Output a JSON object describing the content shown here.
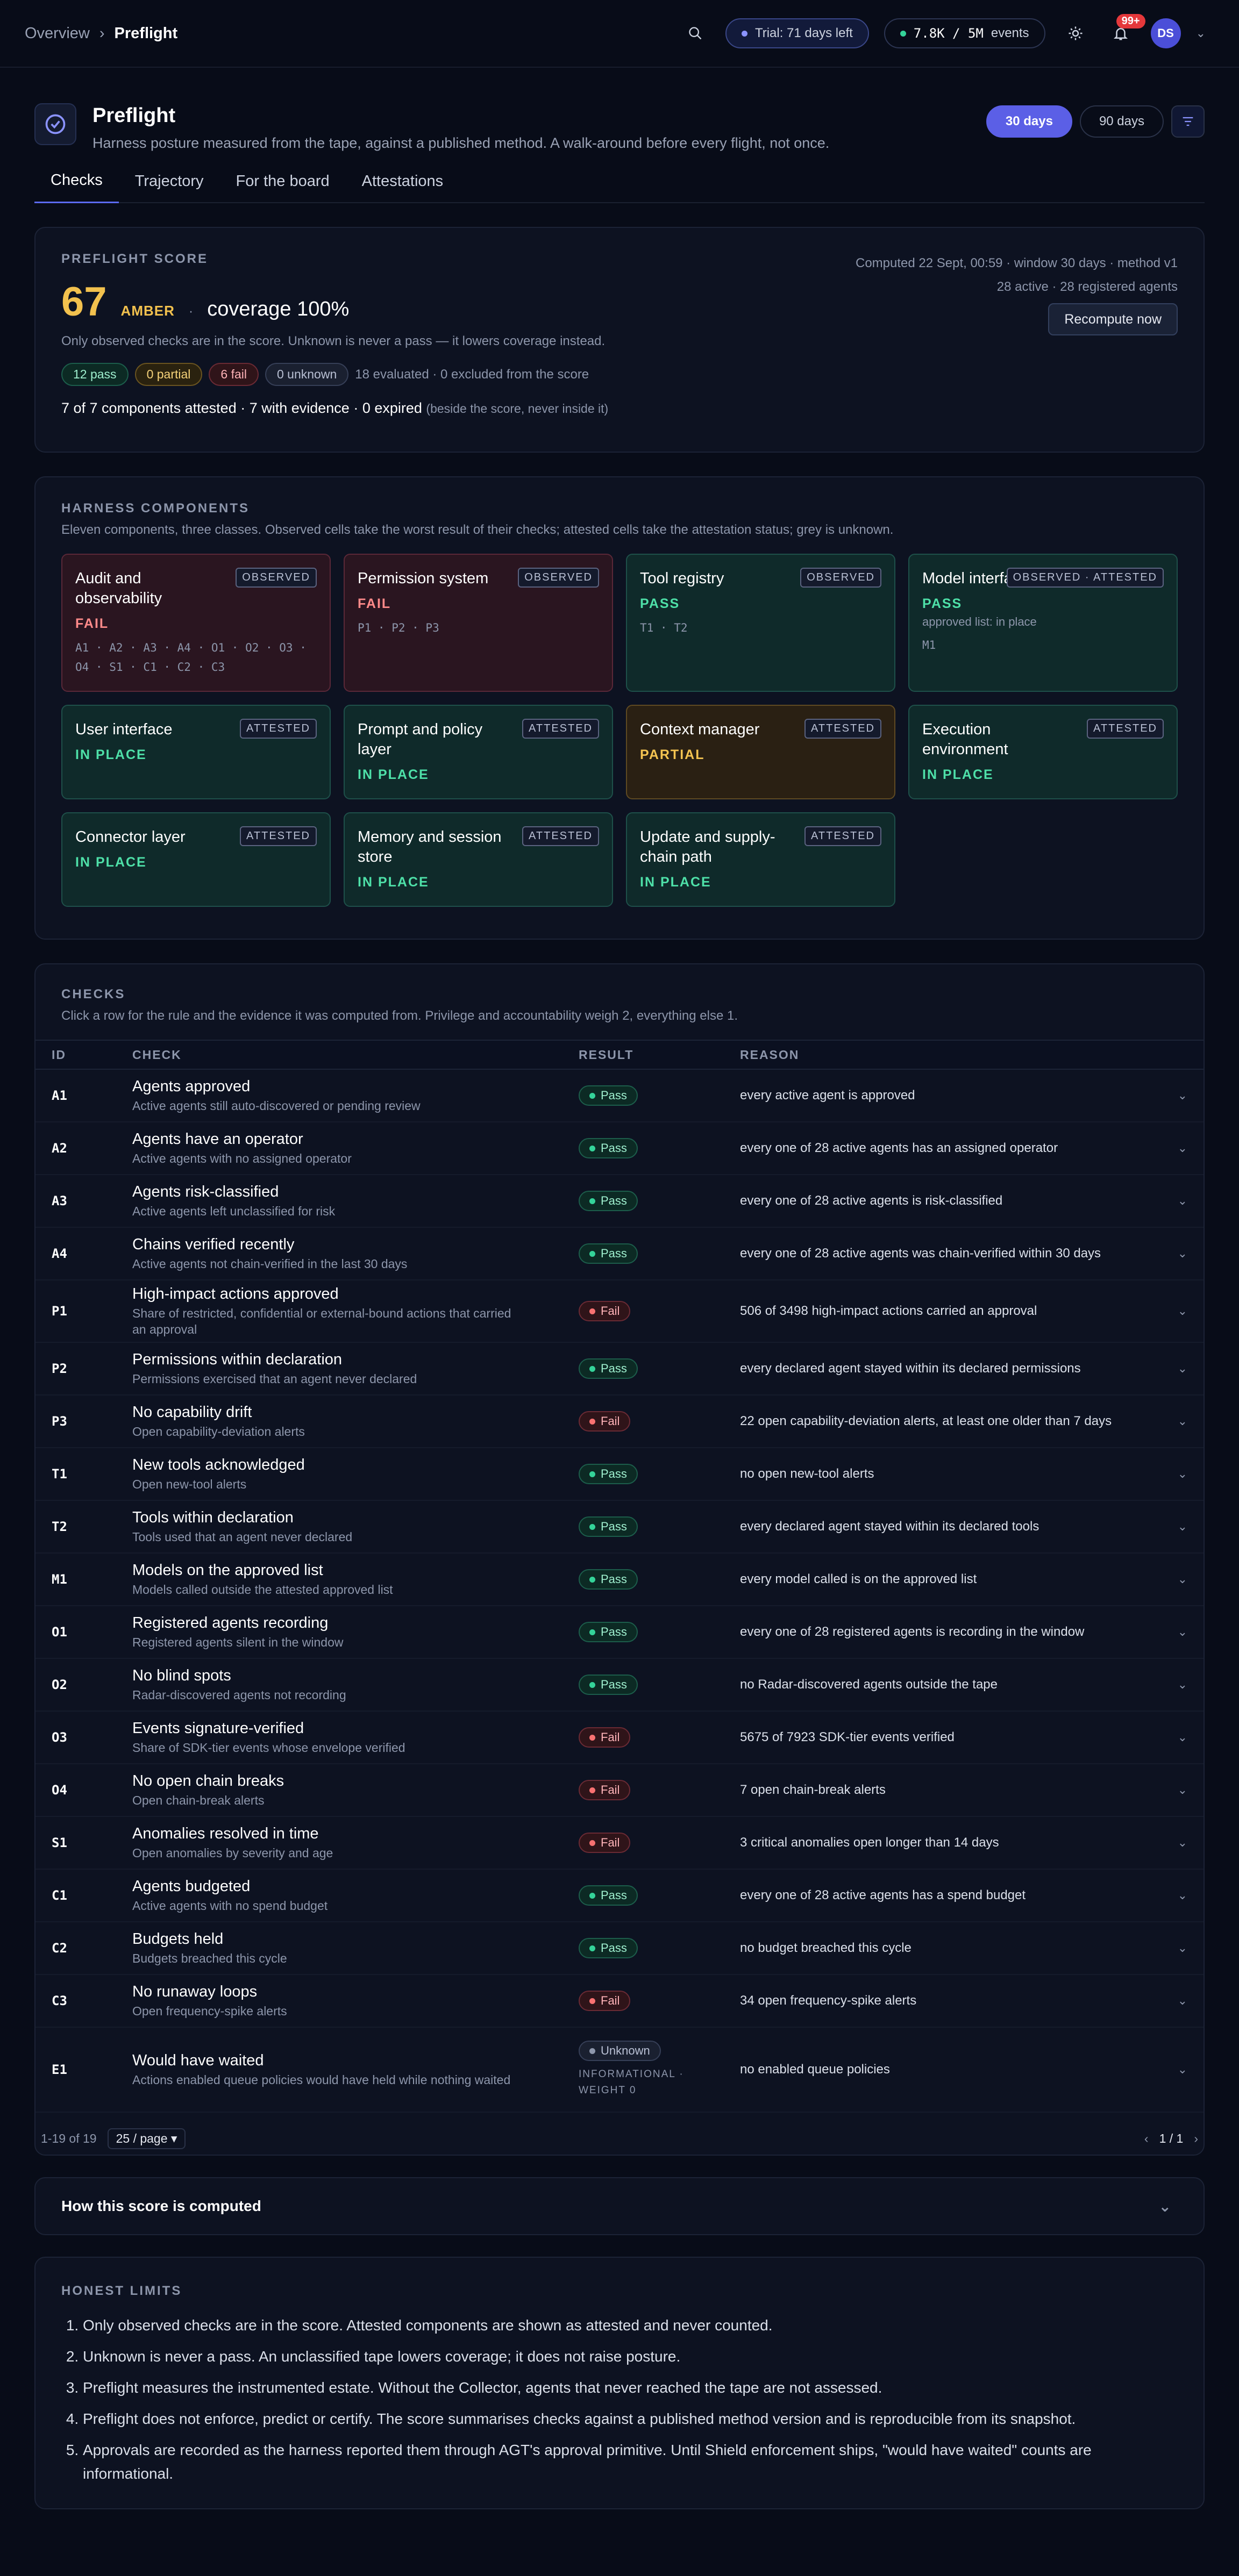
{
  "nav": {
    "overview": "Overview",
    "current": "Preflight",
    "trial": "Trial: 71 days left",
    "events_count": "7.8K / 5M",
    "events_label": "events",
    "notif_count": "99+",
    "avatar": "DS"
  },
  "header": {
    "title": "Preflight",
    "subtitle": "Harness posture measured from the tape, against a published method. A walk-around before every flight, not once.",
    "range_30": "30 days",
    "range_90": "90 days"
  },
  "tabs": [
    "Checks",
    "Trajectory",
    "For the board",
    "Attestations"
  ],
  "score": {
    "label": "PREFLIGHT SCORE",
    "value": "67",
    "band": "AMBER",
    "coverage": "coverage 100%",
    "computed": "Computed 22 Sept, 00:59 · window 30 days · method v1",
    "agents": "28 active · 28 registered agents",
    "recompute": "Recompute now",
    "note": "Only observed checks are in the score. Unknown is never a pass — it lowers coverage instead.",
    "chips": {
      "pass": "12 pass",
      "partial": "0 partial",
      "fail": "6 fail",
      "unknown": "0 unknown"
    },
    "evaluated": "18 evaluated · 0 excluded from the score",
    "attest": "7 of 7 components attested · 7 with evidence · 0 expired",
    "attest_note": "(beside the score, never inside it)",
    "colors": {
      "amber": "#f2c14e",
      "pass": "#34d399",
      "fail": "#f87171"
    }
  },
  "components": {
    "label": "HARNESS COMPONENTS",
    "desc": "Eleven components, three classes. Observed cells take the worst result of their checks; attested cells take the attestation status; grey is unknown.",
    "items": [
      {
        "name": "Audit and observability",
        "tag": "OBSERVED",
        "status": "FAIL",
        "kind": "fail",
        "ids": "A1 · A2 · A3 · A4 · O1 · O2 · O3 · O4 · S1 · C1 · C2 · C3"
      },
      {
        "name": "Permission system",
        "tag": "OBSERVED",
        "status": "FAIL",
        "kind": "fail",
        "ids": "P1 · P2 · P3"
      },
      {
        "name": "Tool registry",
        "tag": "OBSERVED",
        "status": "PASS",
        "kind": "pass",
        "ids": "T1 · T2"
      },
      {
        "name": "Model interface",
        "tag": "OBSERVED · ATTESTED",
        "status": "PASS",
        "kind": "pass",
        "extra": "approved list: in place",
        "ids": "M1"
      },
      {
        "name": "User interface",
        "tag": "ATTESTED",
        "status": "IN PLACE",
        "kind": "pass"
      },
      {
        "name": "Prompt and policy layer",
        "tag": "ATTESTED",
        "status": "IN PLACE",
        "kind": "pass"
      },
      {
        "name": "Context manager",
        "tag": "ATTESTED",
        "status": "PARTIAL",
        "kind": "part"
      },
      {
        "name": "Execution environment",
        "tag": "ATTESTED",
        "status": "IN PLACE",
        "kind": "pass"
      },
      {
        "name": "Connector layer",
        "tag": "ATTESTED",
        "status": "IN PLACE",
        "kind": "pass"
      },
      {
        "name": "Memory and session store",
        "tag": "ATTESTED",
        "status": "IN PLACE",
        "kind": "pass"
      },
      {
        "name": "Update and supply-chain path",
        "tag": "ATTESTED",
        "status": "IN PLACE",
        "kind": "pass"
      }
    ]
  },
  "checks": {
    "label": "CHECKS",
    "desc": "Click a row for the rule and the evidence it was computed from. Privilege and accountability weigh 2, everything else 1.",
    "cols": [
      "ID",
      "CHECK",
      "RESULT",
      "REASON"
    ],
    "rows": [
      {
        "id": "A1",
        "title": "Agents approved",
        "sub": "Active agents still auto-discovered or pending review",
        "result": "Pass",
        "reason": "every active agent is approved"
      },
      {
        "id": "A2",
        "title": "Agents have an operator",
        "sub": "Active agents with no assigned operator",
        "result": "Pass",
        "reason": "every one of 28 active agents has an assigned operator"
      },
      {
        "id": "A3",
        "title": "Agents risk-classified",
        "sub": "Active agents left unclassified for risk",
        "result": "Pass",
        "reason": "every one of 28 active agents is risk-classified"
      },
      {
        "id": "A4",
        "title": "Chains verified recently",
        "sub": "Active agents not chain-verified in the last 30 days",
        "result": "Pass",
        "reason": "every one of 28 active agents was chain-verified within 30 days"
      },
      {
        "id": "P1",
        "title": "High-impact actions approved",
        "sub": "Share of restricted, confidential or external-bound actions that carried an approval",
        "result": "Fail",
        "reason": "506 of 3498 high-impact actions carried an approval"
      },
      {
        "id": "P2",
        "title": "Permissions within declaration",
        "sub": "Permissions exercised that an agent never declared",
        "result": "Pass",
        "reason": "every declared agent stayed within its declared permissions"
      },
      {
        "id": "P3",
        "title": "No capability drift",
        "sub": "Open capability-deviation alerts",
        "result": "Fail",
        "reason": "22 open capability-deviation alerts, at least one older than 7 days"
      },
      {
        "id": "T1",
        "title": "New tools acknowledged",
        "sub": "Open new-tool alerts",
        "result": "Pass",
        "reason": "no open new-tool alerts"
      },
      {
        "id": "T2",
        "title": "Tools within declaration",
        "sub": "Tools used that an agent never declared",
        "result": "Pass",
        "reason": "every declared agent stayed within its declared tools"
      },
      {
        "id": "M1",
        "title": "Models on the approved list",
        "sub": "Models called outside the attested approved list",
        "result": "Pass",
        "reason": "every model called is on the approved list"
      },
      {
        "id": "O1",
        "title": "Registered agents recording",
        "sub": "Registered agents silent in the window",
        "result": "Pass",
        "reason": "every one of 28 registered agents is recording in the window"
      },
      {
        "id": "O2",
        "title": "No blind spots",
        "sub": "Radar-discovered agents not recording",
        "result": "Pass",
        "reason": "no Radar-discovered agents outside the tape"
      },
      {
        "id": "O3",
        "title": "Events signature-verified",
        "sub": "Share of SDK-tier events whose envelope verified",
        "result": "Fail",
        "reason": "5675 of 7923 SDK-tier events verified"
      },
      {
        "id": "O4",
        "title": "No open chain breaks",
        "sub": "Open chain-break alerts",
        "result": "Fail",
        "reason": "7 open chain-break alerts"
      },
      {
        "id": "S1",
        "title": "Anomalies resolved in time",
        "sub": "Open anomalies by severity and age",
        "result": "Fail",
        "reason": "3 critical anomalies open longer than 14 days"
      },
      {
        "id": "C1",
        "title": "Agents budgeted",
        "sub": "Active agents with no spend budget",
        "result": "Pass",
        "reason": "every one of 28 active agents has a spend budget"
      },
      {
        "id": "C2",
        "title": "Budgets held",
        "sub": "Budgets breached this cycle",
        "result": "Pass",
        "reason": "no budget breached this cycle"
      },
      {
        "id": "C3",
        "title": "No runaway loops",
        "sub": "Open frequency-spike alerts",
        "result": "Fail",
        "reason": "34 open frequency-spike alerts"
      },
      {
        "id": "E1",
        "title": "Would have waited",
        "sub": "Actions enabled queue policies would have held while nothing waited",
        "result": "Unknown",
        "result_note": "INFORMATIONAL · WEIGHT 0",
        "reason": "no enabled queue policies"
      }
    ],
    "pager_count": "1-19 of 19",
    "per_page": "25 / page",
    "page": "1 / 1"
  },
  "how": {
    "label": "How this score is computed"
  },
  "limits": {
    "label": "HONEST LIMITS",
    "items": [
      "Only observed checks are in the score. Attested components are shown as attested and never counted.",
      "Unknown is never a pass. An unclassified tape lowers coverage; it does not raise posture.",
      "Preflight measures the instrumented estate. Without the Collector, agents that never reached the tape are not assessed.",
      "Preflight does not enforce, predict or certify. The score summarises checks against a published method version and is reproducible from its snapshot.",
      "Approvals are recorded as the harness reported them through AGT's approval primitive. Until Shield enforcement ships, \"would have waited\" counts are informational."
    ]
  }
}
